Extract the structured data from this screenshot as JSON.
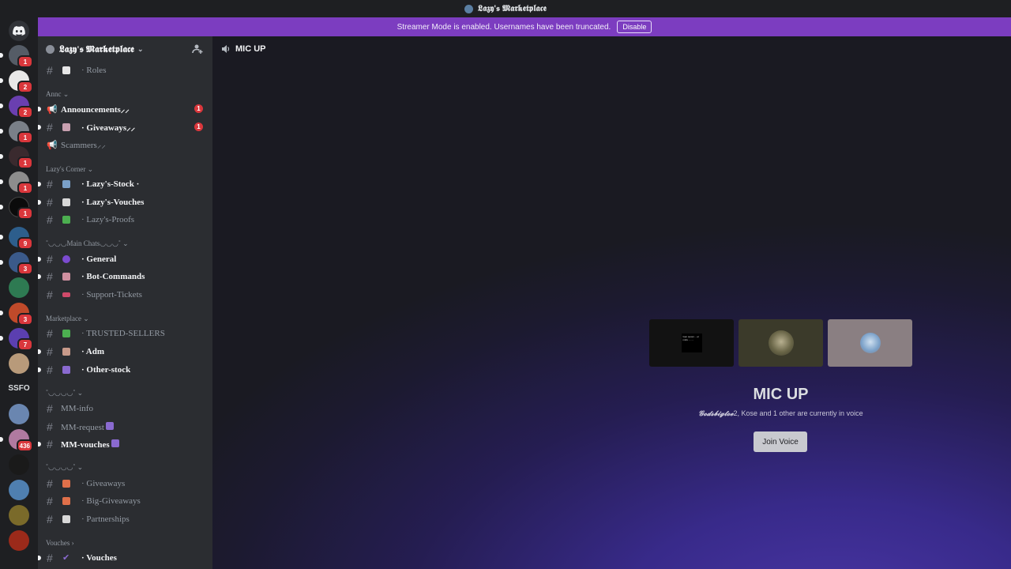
{
  "window": {
    "title": "𝕷𝖆𝖟𝖞'𝖘 𝕸𝖆𝖗𝖐𝖊𝖙𝖕𝖑𝖆𝖈𝖊"
  },
  "streamer_banner": {
    "text": "Streamer Mode is enabled. Usernames have been truncated.",
    "button": "Disable"
  },
  "guild_bar": {
    "badges": [
      "1",
      "2",
      "2",
      "1",
      "1",
      "1",
      "1",
      "9",
      "3",
      "3",
      "7",
      "436"
    ],
    "text_guild": "SSFO"
  },
  "server": {
    "name": "𝕷𝖆𝖟𝖞'𝖘 𝕸𝖆𝖗𝖐𝖊𝖙𝖕𝖑𝖆𝖈𝖊"
  },
  "categories": {
    "annc": "Annc",
    "lazys_corner": "Lazy's Corner",
    "main_chats": "˚◡◡◡Main Chats◡◡◡˚",
    "marketplace": "Marketplace",
    "mm": "˚◡◡◡◡˚",
    "giveaways": "˚◡◡◡◡˚",
    "vouches": "Vouches"
  },
  "channels": {
    "roles": "· Roles",
    "announcements": "Announcements⸝⸝",
    "giveaways_annc": "· Giveaways⸝⸝",
    "scammers": "Scammers⸝⸝",
    "lazys_stock": "· Lazy's-Stock ·",
    "lazys_vouches": "· Lazy's-Vouches",
    "lazys_proofs": "· Lazy's-Proofs",
    "general": "· General",
    "bot_commands": "· Bot-Commands",
    "support_tickets": "· Support-Tickets",
    "trusted_sellers": "· TRUSTED-SELLERS",
    "adm": "· Adm",
    "other_stock": "· Other-stock",
    "mm_info": "MM-info",
    "mm_request": "MM-request",
    "mm_vouches": "MM-vouches",
    "giveaways": "· Giveaways",
    "big_giveaways": "· Big-Giveaways",
    "partnerships": "· Partnerships",
    "vouches": "· Vouches"
  },
  "channel_badges": {
    "announcements": "1",
    "giveaways_annc": "1"
  },
  "voice_channel": {
    "header": "MIC UP",
    "title": "MIC UP",
    "user_name": "𝓖𝓸𝓭𝓼𝓫𝓲𝓰𝓽𝓸𝓮",
    "subtitle_rest": "2, Kose and 1 other are currently in voice",
    "join_button": "Join Voice",
    "tile1_text": "Gen seven... er mids  ........"
  },
  "colors": {
    "accent": "#7c3dc0",
    "badge": "#da373c",
    "sidebar": "#2b2d31",
    "guilds": "#1e1f22"
  }
}
